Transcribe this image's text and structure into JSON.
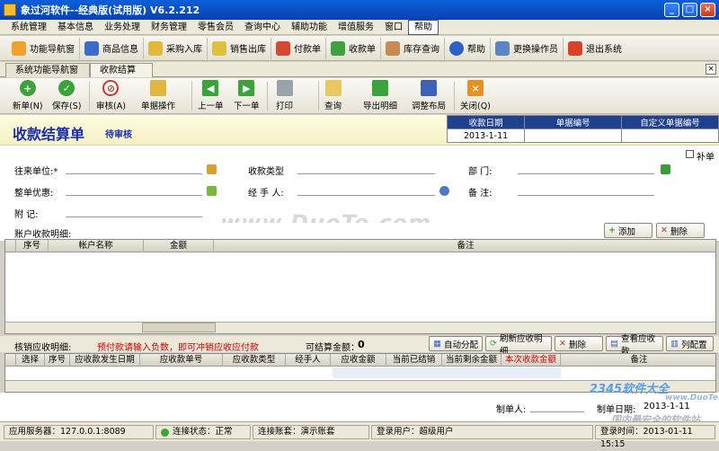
{
  "window": {
    "title": "象过河软件--经典版(试用版) V6.2.212"
  },
  "menu": [
    "系统管理",
    "基本信息",
    "业务处理",
    "财务管理",
    "零售会员",
    "查询中心",
    "辅助功能",
    "增值服务",
    "窗口",
    "帮助"
  ],
  "toolbar1": [
    "功能导航窗",
    "商品信息",
    "采购入库",
    "销售出库",
    "付款单",
    "收款单",
    "库存查询",
    "帮助",
    "更换操作员",
    "退出系统"
  ],
  "tabs": [
    "系统功能导航窗",
    "收款结算单"
  ],
  "toolbar2": [
    "新单(N)",
    "保存(S)",
    "审核(A)",
    "单据操作",
    "上一单",
    "下一单",
    "打印",
    "查询",
    "导出明细",
    "调整布局",
    "关闭(Q)"
  ],
  "header": {
    "title": "收款结算单",
    "status": "待审核",
    "col_date": "收款日期",
    "col_no": "单据编号",
    "col_custom": "自定义单据编号",
    "date_value": "2013-1-11"
  },
  "form": {
    "supplement": "补单",
    "unit_label": "往来单位:*",
    "type_label": "收款类型",
    "dept_label": "部    门:",
    "discount_label": "整单优惠:",
    "handler_label": "经 手 人:",
    "remark_label": "备    注:",
    "memo_label": "附    记:"
  },
  "detail": {
    "label": "账户收款明细:",
    "add": "添加",
    "delete": "删除",
    "cols": [
      "序号",
      "帐户名称",
      "金额",
      "备注"
    ]
  },
  "writeoff": {
    "label": "核销应收明细:",
    "hint": "预付款请输入负数，即可冲销应收应付款",
    "settle_label": "可结算金额：",
    "settle_value": "0",
    "buttons": [
      "自动分配",
      "刷新应收明细",
      "删除",
      "查看应收款",
      "列配置"
    ],
    "cols": [
      "选择",
      "序号",
      "应收款发生日期",
      "应收款单号",
      "应收款类型",
      "经手人",
      "应收金额",
      "当前已结销",
      "当前剩余金额",
      "本次收款金额",
      "备注"
    ]
  },
  "footer": {
    "maker_label": "制单人:",
    "make_date_label": "制单日期:",
    "make_date_value": "2013-1-11"
  },
  "status": {
    "server": "应用服务器：127.0.0.1:8089",
    "conn": "连接状态：正常",
    "account": "连接账套：演示账套",
    "user": "登录用户：超级用户",
    "time": "登录时间：2013-01-11 15:15"
  },
  "watermarks": {
    "main": "www.DuoTe.com",
    "corner": "2345软件大全",
    "corner2": "www.DuoTe.com",
    "corner3": "国内最安全的软件站"
  },
  "colors": {
    "title_bar": "#0842b5",
    "header_cell": "#1f3f8f",
    "title_text": "#1a2faa",
    "hint": "#d00000"
  }
}
